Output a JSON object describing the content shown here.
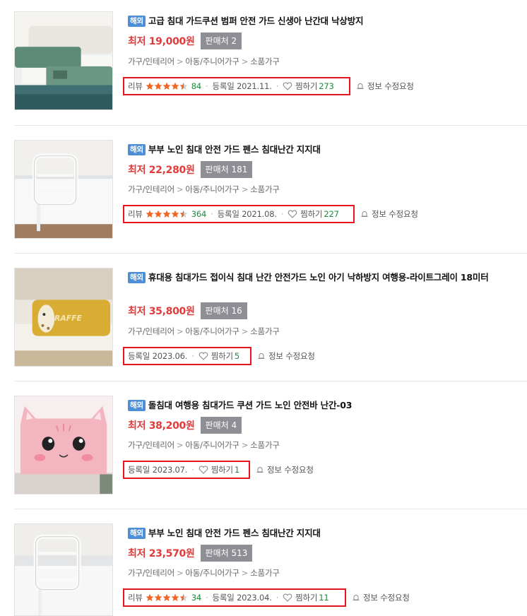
{
  "items": [
    {
      "badge": "해외",
      "title": "고급 침대 가드쿠션 범퍼 안전 가드 신생아 난간대 낙상방지",
      "price": "최저 19,000원",
      "sellers": "판매처 2",
      "categories": [
        "가구/인테리어",
        "아동/주니어가구",
        "소품가구"
      ],
      "review_label": "리뷰",
      "rating": 4.5,
      "review_count": "84",
      "date": "등록일 2021.11.",
      "wish_label": "찜하기",
      "wish_count": "273",
      "report": "정보 수정요청"
    },
    {
      "badge": "해외",
      "title": "부부 노인 침대 안전 가드 펜스 침대난간 지지대",
      "price": "최저 22,280원",
      "sellers": "판매처 181",
      "categories": [
        "가구/인테리어",
        "아동/주니어가구",
        "소품가구"
      ],
      "review_label": "리뷰",
      "rating": 4.5,
      "review_count": "364",
      "date": "등록일 2021.08.",
      "wish_label": "찜하기",
      "wish_count": "227",
      "report": "정보 수정요청"
    },
    {
      "badge": "해외",
      "title": "휴대용 침대가드 접이식 침대 난간 안전가드 노인 아기 낙하방지 여행용-라이트그레이 18미터",
      "price": "최저 35,800원",
      "sellers": "판매처 16",
      "categories": [
        "가구/인테리어",
        "아동/주니어가구",
        "소품가구"
      ],
      "date": "등록일 2023.06.",
      "wish_label": "찜하기",
      "wish_count": "5",
      "report": "정보 수정요청"
    },
    {
      "badge": "해외",
      "title": "돌침대 여행용 침대가드 쿠션 가드 노인 안전바 난간-03",
      "price": "최저 38,200원",
      "sellers": "판매처 4",
      "categories": [
        "가구/인테리어",
        "아동/주니어가구",
        "소품가구"
      ],
      "date": "등록일 2023.07.",
      "wish_label": "찜하기",
      "wish_count": "1",
      "report": "정보 수정요청"
    },
    {
      "badge": "해외",
      "title": "부부 노인 침대 안전 가드 펜스 침대난간 지지대",
      "price": "최저 23,570원",
      "sellers": "판매처 513",
      "categories": [
        "가구/인테리어",
        "아동/주니어가구",
        "소품가구"
      ],
      "review_label": "리뷰",
      "rating": 4.5,
      "review_count": "34",
      "date": "등록일 2023.04.",
      "wish_label": "찜하기",
      "wish_count": "11",
      "report": "정보 수정요청"
    }
  ],
  "image_text": {
    "giraffe": "GIRAFFE"
  },
  "colors": {
    "price_red": "#e03b3b",
    "badge_blue": "#4d8fd6",
    "highlight_red": "#e8141f",
    "count_green": "#1b8a3a",
    "star_orange": "#f26522"
  }
}
